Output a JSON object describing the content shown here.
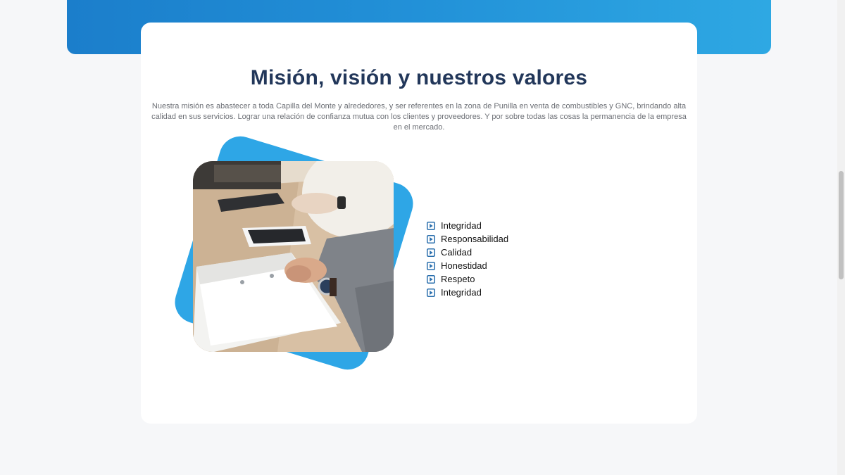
{
  "section": {
    "title": "Misión, visión y nuestros valores",
    "description": "Nuestra misión es abastecer a toda Capilla del Monte y alrededores, y ser referentes en la zona de Punilla en venta de combustibles y GNC, brindando alta calidad en sus servicios. Lograr una relación de confianza mutua con los clientes y proveedores. Y por sobre todas las cosas la permanencia de la empresa en el mercado."
  },
  "values": {
    "icon": "play-square-icon",
    "items": [
      "Integridad",
      "Responsabilidad",
      "Calidad",
      "Honestidad",
      "Respeto",
      "Integridad"
    ]
  },
  "colors": {
    "brand_blue": "#1b7ecb",
    "accent_blue": "#2ea6e6",
    "title": "#22375a",
    "icon": "#2a6fad"
  }
}
